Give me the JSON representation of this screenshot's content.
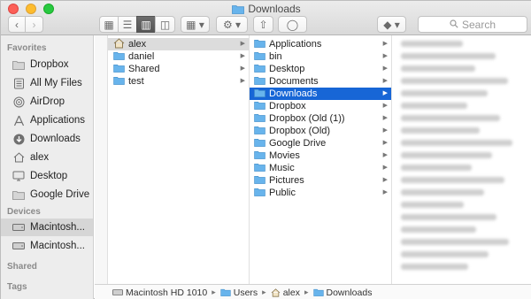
{
  "window": {
    "title": "Downloads"
  },
  "toolbar": {
    "back_label": "‹",
    "forward_label": "›",
    "view_icons_label": "▦",
    "view_list_label": "☰",
    "view_columns_label": "▥",
    "view_cover_label": "◫",
    "arrange_label": "▦ ▾",
    "action_label": "⚙ ▾",
    "share_label": "⇧",
    "tags_label": "◯",
    "dropbox_label": "◆ ▾",
    "search_placeholder": "Search"
  },
  "sidebar": {
    "favorites_header": "Favorites",
    "devices_header": "Devices",
    "shared_header": "Shared",
    "tags_header": "Tags",
    "favorites": [
      {
        "label": "Dropbox",
        "icon": "folder-icon"
      },
      {
        "label": "All My Files",
        "icon": "all-files-icon"
      },
      {
        "label": "AirDrop",
        "icon": "airdrop-icon"
      },
      {
        "label": "Applications",
        "icon": "applications-icon"
      },
      {
        "label": "Downloads",
        "icon": "downloads-icon"
      },
      {
        "label": "alex",
        "icon": "home-icon"
      },
      {
        "label": "Desktop",
        "icon": "desktop-icon"
      },
      {
        "label": "Google Drive",
        "icon": "folder-icon"
      }
    ],
    "devices": [
      {
        "label": "Macintosh...",
        "icon": "hard-drive-icon",
        "selected": true
      },
      {
        "label": "Macintosh...",
        "icon": "hard-drive-icon",
        "selected": false
      }
    ]
  },
  "columns": {
    "users": [
      {
        "label": "alex",
        "icon": "home-icon",
        "has_children": true
      },
      {
        "label": "daniel",
        "icon": "folder-icon",
        "has_children": true
      },
      {
        "label": "Shared",
        "icon": "folder-icon",
        "has_children": true
      },
      {
        "label": "test",
        "icon": "folder-icon",
        "has_children": true
      }
    ],
    "home": [
      {
        "label": "Applications",
        "icon": "folder-icon"
      },
      {
        "label": "bin",
        "icon": "folder-icon"
      },
      {
        "label": "Desktop",
        "icon": "folder-icon"
      },
      {
        "label": "Documents",
        "icon": "folder-icon"
      },
      {
        "label": "Downloads",
        "icon": "folder-icon"
      },
      {
        "label": "Dropbox",
        "icon": "folder-icon"
      },
      {
        "label": "Dropbox (Old (1))",
        "icon": "folder-icon"
      },
      {
        "label": "Dropbox (Old)",
        "icon": "folder-icon"
      },
      {
        "label": "Google Drive",
        "icon": "folder-icon"
      },
      {
        "label": "Movies",
        "icon": "folder-icon"
      },
      {
        "label": "Music",
        "icon": "folder-icon"
      },
      {
        "label": "Pictures",
        "icon": "folder-icon"
      },
      {
        "label": "Public",
        "icon": "folder-icon"
      }
    ]
  },
  "pathbar": {
    "items": [
      "Macintosh HD 1010",
      "Users",
      "alex",
      "Downloads"
    ]
  },
  "colors": {
    "selection_blue": "#1766d6",
    "folder_blue": "#68b4ec",
    "sidebar_bg": "#ededed"
  }
}
